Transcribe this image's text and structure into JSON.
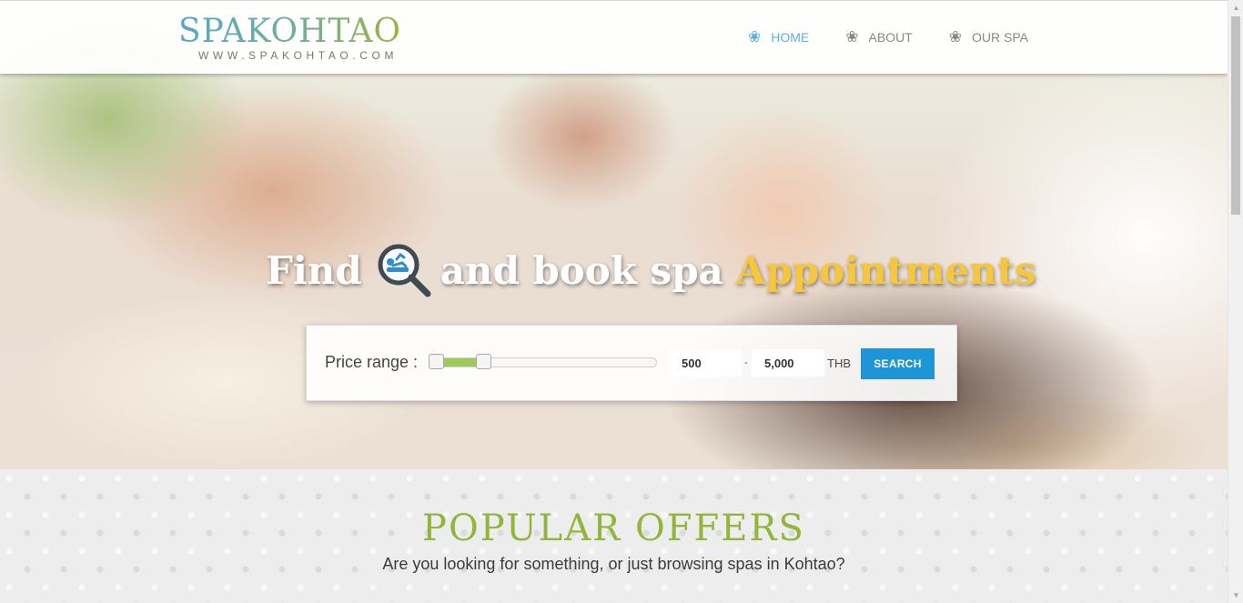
{
  "header": {
    "logo_title": "SPAKOHTAO",
    "logo_subtitle": "WWW.SPAKOHTAO.COM",
    "nav": [
      {
        "label": "HOME",
        "icon": "flower-icon",
        "active": true
      },
      {
        "label": "ABOUT",
        "icon": "flower-icon",
        "active": false
      },
      {
        "label": "OUR SPA",
        "icon": "flower-icon",
        "active": false
      }
    ]
  },
  "hero": {
    "headline_find": "Find",
    "headline_middle": "and book spa",
    "headline_accent": "Appointments",
    "search_icon": "magnifier-spa-icon"
  },
  "price_filter": {
    "label": "Price range :",
    "min_value": "500",
    "max_value": "5,000",
    "separator": "-",
    "currency": "THB",
    "button_label": "SEARCH",
    "slider_range": [
      0.03,
      0.24
    ]
  },
  "offers": {
    "title": "POPULAR  OFFERS",
    "subtitle": "Are you looking for something, or just browsing spas in Kohtao?"
  },
  "colors": {
    "accent_blue": "#1e95d8",
    "nav_active": "#5cb0e2",
    "offers_green": "#93b53c",
    "headline_gold": "#f6c73b",
    "slider_green": "#9ccb58"
  }
}
